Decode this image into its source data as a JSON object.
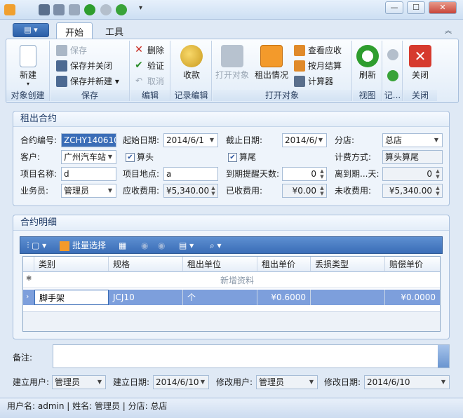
{
  "window": {
    "min": "—",
    "max": "☐",
    "close": "✕"
  },
  "menu_button": {
    "label": "▤ ▾"
  },
  "tabs": [
    "开始",
    "工具"
  ],
  "ribbon": {
    "groups": {
      "create": "对象创建",
      "save": "保存",
      "edit": "编辑",
      "record_edit": "记录编辑",
      "open_object": "打开对象",
      "view": "视图",
      "record": "记...",
      "close": "关闭"
    },
    "new": "新建",
    "save": "保存",
    "save_close": "保存并关闭",
    "save_new": "保存并新建",
    "delete": "删除",
    "verify": "验证",
    "cancel": "取消",
    "receive": "收款",
    "open_obj": "打开对象",
    "rent_info": "租出情况",
    "view_receivable": "查看应收",
    "monthly_settle": "按月结算",
    "calculator": "计算器",
    "refresh": "刷新",
    "close": "关闭"
  },
  "contract": {
    "title": "租出合约",
    "labels": {
      "contract_no": "合约编号:",
      "start_date": "起始日期:",
      "end_date": "截止日期:",
      "branch": "分店:",
      "customer": "客户:",
      "head_calc": "算头",
      "tail_calc": "算尾",
      "billing": "计费方式:",
      "project_name": "项目名称:",
      "project_site": "项目地点:",
      "remind_days": "到期提醒天数:",
      "days_left": "离到期...天:",
      "salesman": "业务员:",
      "receivable": "应收费用:",
      "received": "已收费用:",
      "unreceived": "未收费用:"
    },
    "values": {
      "contract_no": "ZCHY140610",
      "start_date": "2014/6/1",
      "end_date": "2014/6/",
      "branch": "总店",
      "customer": "广州汽车站",
      "billing": "算头算尾",
      "project_name": "d",
      "project_site": "a",
      "remind_days": "0",
      "days_left": "0",
      "salesman": "管理员",
      "receivable": "¥5,340.00",
      "received": "¥0.00",
      "unreceived": "¥5,340.00"
    }
  },
  "details": {
    "title": "合约明细",
    "toolbar": {
      "batch_select": "批量选择"
    },
    "columns": [
      "类别",
      "规格",
      "租出单位",
      "租出单价",
      "丢损类型",
      "赔偿单价"
    ],
    "new_row": "新增资料",
    "rows": [
      {
        "category": "脚手架",
        "spec": "JCJ10",
        "unit": "个",
        "price": "¥0.6000",
        "loss_type": "",
        "comp_price": "¥0.0000"
      }
    ]
  },
  "footer": {
    "remark_label": "备注:",
    "created_by_label": "建立用户:",
    "created_by": "管理员",
    "created_date_label": "建立日期:",
    "created_date": "2014/6/10",
    "modified_by_label": "修改用户:",
    "modified_by": "管理员",
    "modified_date_label": "修改日期:",
    "modified_date": "2014/6/10"
  },
  "status": {
    "text": "用户名: admin  |  姓名: 管理员  |  分店: 总店"
  },
  "colors": {
    "accent": "#3a6db7",
    "selected_row": "#7d9fdc"
  }
}
